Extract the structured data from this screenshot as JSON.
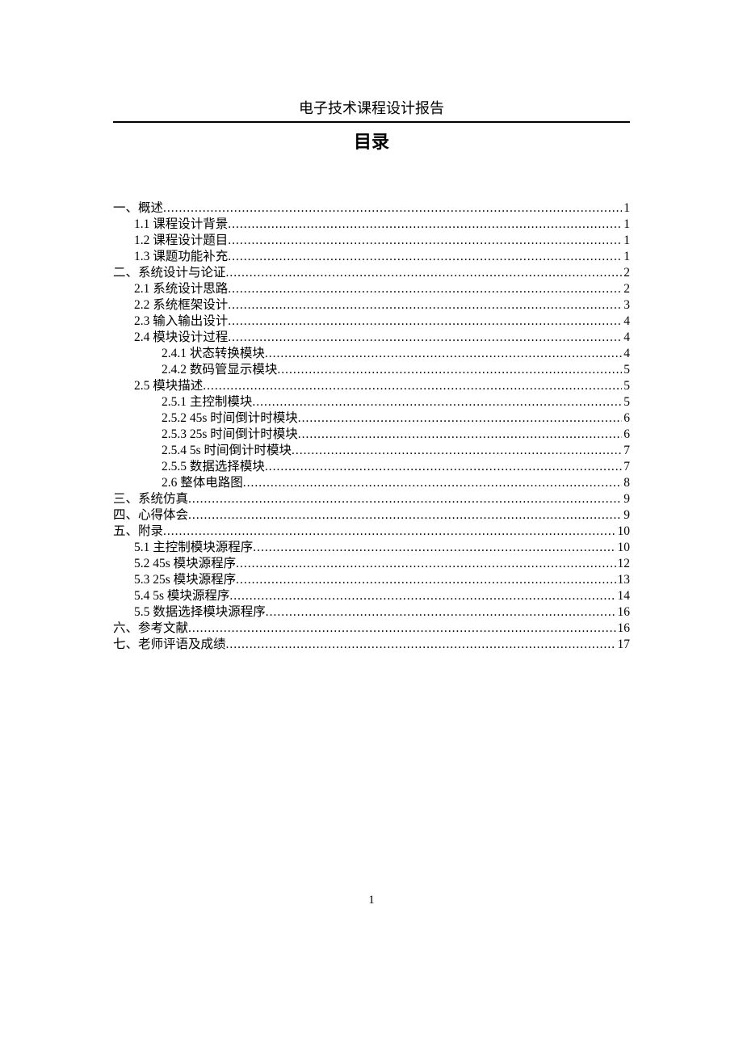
{
  "header": "电子技术课程设计报告",
  "toc_title": "目录",
  "footer_page": "1",
  "toc": [
    {
      "indent": 0,
      "label": "一、概述",
      "page": "1"
    },
    {
      "indent": 1,
      "label": "1.1 课程设计背景",
      "page": "1"
    },
    {
      "indent": 1,
      "label": "1.2 课程设计题目",
      "page": "1"
    },
    {
      "indent": 1,
      "label": "1.3 课题功能补充 ",
      "page": "1"
    },
    {
      "indent": 0,
      "label": "二、系统设计与论证 ",
      "page": "2"
    },
    {
      "indent": 1,
      "label": "2.1 系统设计思路",
      "page": "2"
    },
    {
      "indent": 1,
      "label": "2.2 系统框架设计",
      "page": "3"
    },
    {
      "indent": 1,
      "label": "2.3 输入输出设计",
      "page": "4"
    },
    {
      "indent": 1,
      "label": "2.4 模块设计过程",
      "page": "4"
    },
    {
      "indent": 2,
      "label": "2.4.1 状态转换模块",
      "page": "4"
    },
    {
      "indent": 2,
      "label": "2.4.2 数码管显示模块",
      "page": "5"
    },
    {
      "indent": 1,
      "label": "2.5 模块描述",
      "page": "5"
    },
    {
      "indent": 2,
      "label": "2.5.1 主控制模块",
      "page": "5"
    },
    {
      "indent": 2,
      "label": "2.5.2 45s 时间倒计时模块",
      "page": "6"
    },
    {
      "indent": 2,
      "label": "2.5.3 25s 时间倒计时模块",
      "page": "6"
    },
    {
      "indent": 2,
      "label": "2.5.4 5s 时间倒计时模块",
      "page": "7"
    },
    {
      "indent": 2,
      "label": "2.5.5 数据选择模块",
      "page": "7"
    },
    {
      "indent": 2,
      "label": "2.6 整体电路图",
      "page": "8"
    },
    {
      "indent": 0,
      "label": "三、系统仿真",
      "page": "9"
    },
    {
      "indent": 0,
      "label": "四、心得体会",
      "page": "9"
    },
    {
      "indent": 0,
      "label": "五、附录",
      "page": "10"
    },
    {
      "indent": 1,
      "label": "5.1 主控制模块源程序",
      "page": "10"
    },
    {
      "indent": 1,
      "label": "5.2 45s 模块源程序",
      "page": "12"
    },
    {
      "indent": 1,
      "label": "5.3  25s 模块源程序",
      "page": "13"
    },
    {
      "indent": 1,
      "label": "5.4  5s 模块源程序",
      "page": "14"
    },
    {
      "indent": 1,
      "label": "5.5 数据选择模块源程序",
      "page": "16"
    },
    {
      "indent": 0,
      "label": "六、参考文献",
      "page": "16"
    },
    {
      "indent": 0,
      "label": "七、老师评语及成绩",
      "page": "17"
    }
  ]
}
